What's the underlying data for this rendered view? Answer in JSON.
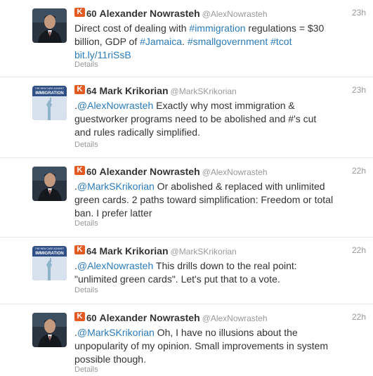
{
  "tweets": [
    {
      "avatar_icon": "man-portrait-avatar",
      "klout_icon": "klout-icon",
      "klout_glyph": "K",
      "klout_score": "60",
      "name": "Alexander Nowrasteh",
      "handle": "@AlexNowrasteh",
      "time": "23h",
      "segments": [
        {
          "text": "Direct cost of dealing with ",
          "link": false
        },
        {
          "text": "#immigration",
          "link": true
        },
        {
          "text": " regulations = $30 billion, GDP of ",
          "link": false
        },
        {
          "text": "#Jamaica",
          "link": true
        },
        {
          "text": ". ",
          "link": false
        },
        {
          "text": "#smallgovernment",
          "link": true
        },
        {
          "text": " ",
          "link": false
        },
        {
          "text": "#tcot",
          "link": true
        },
        {
          "text": " ",
          "link": false
        },
        {
          "text": "bit.ly/11riSsB",
          "link": true
        }
      ],
      "details": "Details"
    },
    {
      "avatar_icon": "book-cover-avatar",
      "avatar_caption_top": "THE NEW CASE AGAINST",
      "avatar_caption_main": "IMMIGRATION",
      "klout_icon": "klout-icon",
      "klout_glyph": "K",
      "klout_score": "64",
      "name": "Mark Krikorian",
      "handle": "@MarkSKrikorian",
      "time": "23h",
      "segments": [
        {
          "text": ".",
          "link": false
        },
        {
          "text": "@AlexNowrasteh",
          "link": true
        },
        {
          "text": " Exactly why most immigration & guestworker programs need to be abolished and #'s cut and rules radically simplified.",
          "link": false
        }
      ],
      "details": "Details"
    },
    {
      "avatar_icon": "man-portrait-avatar",
      "klout_icon": "klout-icon",
      "klout_glyph": "K",
      "klout_score": "60",
      "name": "Alexander Nowrasteh",
      "handle": "@AlexNowrasteh",
      "time": "22h",
      "segments": [
        {
          "text": ".",
          "link": false
        },
        {
          "text": "@MarkSKrikorian",
          "link": true
        },
        {
          "text": " Or abolished & replaced with unlimited green cards. 2 paths toward simplification: Freedom or total ban. I prefer latter",
          "link": false
        }
      ],
      "details": "Details"
    },
    {
      "avatar_icon": "book-cover-avatar",
      "avatar_caption_top": "THE NEW CASE AGAINST",
      "avatar_caption_main": "IMMIGRATION",
      "klout_icon": "klout-icon",
      "klout_glyph": "K",
      "klout_score": "64",
      "name": "Mark Krikorian",
      "handle": "@MarkSKrikorian",
      "time": "22h",
      "segments": [
        {
          "text": ".",
          "link": false
        },
        {
          "text": "@AlexNowrasteh",
          "link": true
        },
        {
          "text": " This drills down to the real point: \"unlimited green cards\". Let's put that to a vote.",
          "link": false
        }
      ],
      "details": "Details"
    },
    {
      "avatar_icon": "man-portrait-avatar",
      "klout_icon": "klout-icon",
      "klout_glyph": "K",
      "klout_score": "60",
      "name": "Alexander Nowrasteh",
      "handle": "@AlexNowrasteh",
      "time": "22h",
      "segments": [
        {
          "text": ".",
          "link": false
        },
        {
          "text": "@MarkSKrikorian",
          "link": true
        },
        {
          "text": " Oh, I have no illusions about the unpopularity of my opinion. Small improvements in system possible though.",
          "link": false
        }
      ],
      "details": "Details"
    }
  ],
  "colors": {
    "link": "#2b7bb9",
    "klout": "#e35a23",
    "muted": "#999999",
    "text": "#333333",
    "divider": "#e8e8e8"
  }
}
